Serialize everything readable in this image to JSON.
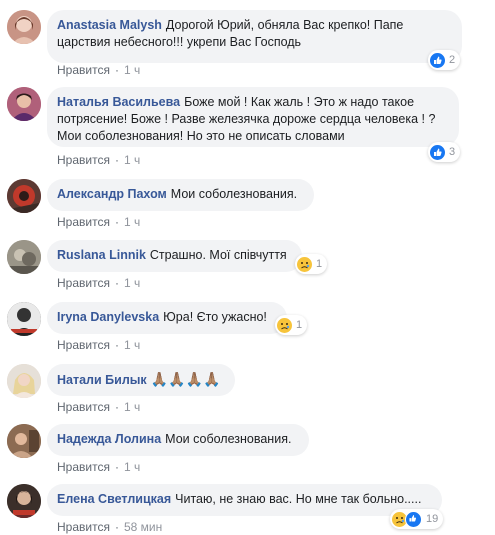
{
  "comments": [
    {
      "author": "Anastasia Malysh",
      "text": "Дорогой Юрий, обняла Вас крепко! Папе царствия небесного!!! укрепи Вас Господь",
      "like_label": "Нравится",
      "time": "1 ч",
      "reactions": {
        "types": [
          "like"
        ],
        "count": "2"
      },
      "avatar_color": "#d9a89a"
    },
    {
      "author": "Наталья Васильева",
      "text": "Боже мой ! Как жаль ! Это ж надо такое потрясение! Боже ! Разве железячка дороже сердца человека ! ? Мои соболезнования! Но это не описать словами",
      "like_label": "Нравится",
      "time": "1 ч",
      "reactions": {
        "types": [
          "like"
        ],
        "count": "3"
      },
      "avatar_color": "#a0566b"
    },
    {
      "author": "Александр Пахом",
      "text": "Мои соболезнования.",
      "like_label": "Нравится",
      "time": "1 ч",
      "avatar_color": "#7a2a2a"
    },
    {
      "author": "Ruslana Linnik",
      "text": "Страшно. Мої співчуття",
      "like_label": "Нравится",
      "time": "1 ч",
      "reactions": {
        "types": [
          "sad"
        ],
        "count": "1"
      },
      "avatar_color": "#8f8a7e"
    },
    {
      "author": "Iryna Danylevska",
      "text": "Юра! Єто ужасно!",
      "like_label": "Нравится",
      "time": "1 ч",
      "reactions": {
        "types": [
          "sad"
        ],
        "count": "1"
      },
      "avatar_color": "#3a3a3a"
    },
    {
      "author": "Натали Билык",
      "text": "🙏🏽🙏🏽🙏🏽🙏🏽",
      "like_label": "Нравится",
      "time": "1 ч",
      "avatar_color": "#d8c7b8"
    },
    {
      "author": "Надежда Лолина",
      "text": "Мои соболезнования.",
      "like_label": "Нравится",
      "time": "1 ч",
      "avatar_color": "#7a5a44"
    },
    {
      "author": "Елена Светлицкая",
      "text": "Читаю, не знаю вас. Но мне так больно.....",
      "like_label": "Нравится",
      "time": "58 мин",
      "reactions": {
        "types": [
          "sad",
          "like"
        ],
        "count": "19"
      },
      "avatar_color": "#4a3b35"
    }
  ],
  "colors": {
    "author": "#385898",
    "bubble": "#f2f3f5",
    "like_blue": "#1877f2",
    "sad_yellow": "#f7c43b"
  }
}
